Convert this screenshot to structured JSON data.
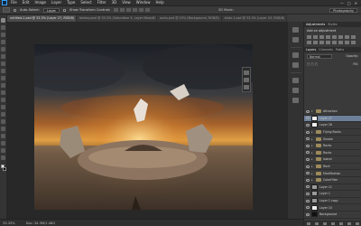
{
  "app": {
    "logo_icon": "ps-logo"
  },
  "menu": [
    "File",
    "Edit",
    "Image",
    "Layer",
    "Type",
    "Select",
    "Filter",
    "3D",
    "View",
    "Window",
    "Help"
  ],
  "window_controls": [
    "—",
    "□",
    "✕"
  ],
  "options": {
    "auto_select_label": "Auto-Select:",
    "auto_select_value": "Layer",
    "show_transform_label": "Show Transform Controls",
    "mode_label": "3D Mode:",
    "workspace": "Photography"
  },
  "tabs": [
    {
      "label": "untitled-1.psd @ 33.3% (Layer 27, RGB/8)",
      "active": true
    },
    {
      "label": "fantasy.psd @ 33.3% (Saturation 4, Layer Mask/8)",
      "active": false
    },
    {
      "label": "rocks.psd @ 25% (Background, RGB/8)",
      "active": false
    },
    {
      "label": "birds-1.psd @ 33.3% (Layer 20, RGB/8)",
      "active": false
    }
  ],
  "panels": {
    "adjustments_tabs": [
      "Adjustments",
      "Styles"
    ],
    "adjustments_title": "Add an adjustment",
    "layers_tabs": [
      "Layers",
      "Channels",
      "Paths"
    ],
    "blend_mode": "Normal",
    "opacity_label": "Opacity:",
    "fill_label": "Fill:"
  },
  "layers": [
    {
      "name": "Attraction",
      "kind": "folder",
      "open": true,
      "selected": false
    },
    {
      "name": "Layer 27",
      "kind": "layer",
      "thumb": "white",
      "selected": true
    },
    {
      "name": "Layer 28",
      "kind": "layer",
      "thumb": "white",
      "selected": false
    },
    {
      "name": "Flying Rocks",
      "kind": "folder",
      "open": false,
      "selected": false
    },
    {
      "name": "Smoke",
      "kind": "folder",
      "open": false,
      "selected": false
    },
    {
      "name": "Rocks",
      "kind": "folder",
      "open": false,
      "selected": false
    },
    {
      "name": "Rocks",
      "kind": "folder",
      "open": false,
      "selected": false
    },
    {
      "name": "Island",
      "kind": "folder",
      "open": false,
      "selected": false
    },
    {
      "name": "Rock",
      "kind": "folder",
      "open": false,
      "selected": false
    },
    {
      "name": "Modification",
      "kind": "folder",
      "open": false,
      "selected": false
    },
    {
      "name": "ColorFilter",
      "kind": "folder",
      "open": false,
      "selected": false
    },
    {
      "name": "Layer 11",
      "kind": "layer",
      "thumb": "grey",
      "selected": false
    },
    {
      "name": "Layer 1",
      "kind": "layer",
      "thumb": "grey",
      "selected": false
    },
    {
      "name": "Layer 1 copy",
      "kind": "layer",
      "thumb": "grey",
      "selected": false
    },
    {
      "name": "Layer 10",
      "kind": "layer",
      "thumb": "white",
      "selected": false
    },
    {
      "name": "Background",
      "kind": "layer",
      "thumb": "black",
      "selected": false
    }
  ],
  "status": {
    "zoom": "33.33%",
    "doc": "Doc: 34.3M/1.46G"
  }
}
